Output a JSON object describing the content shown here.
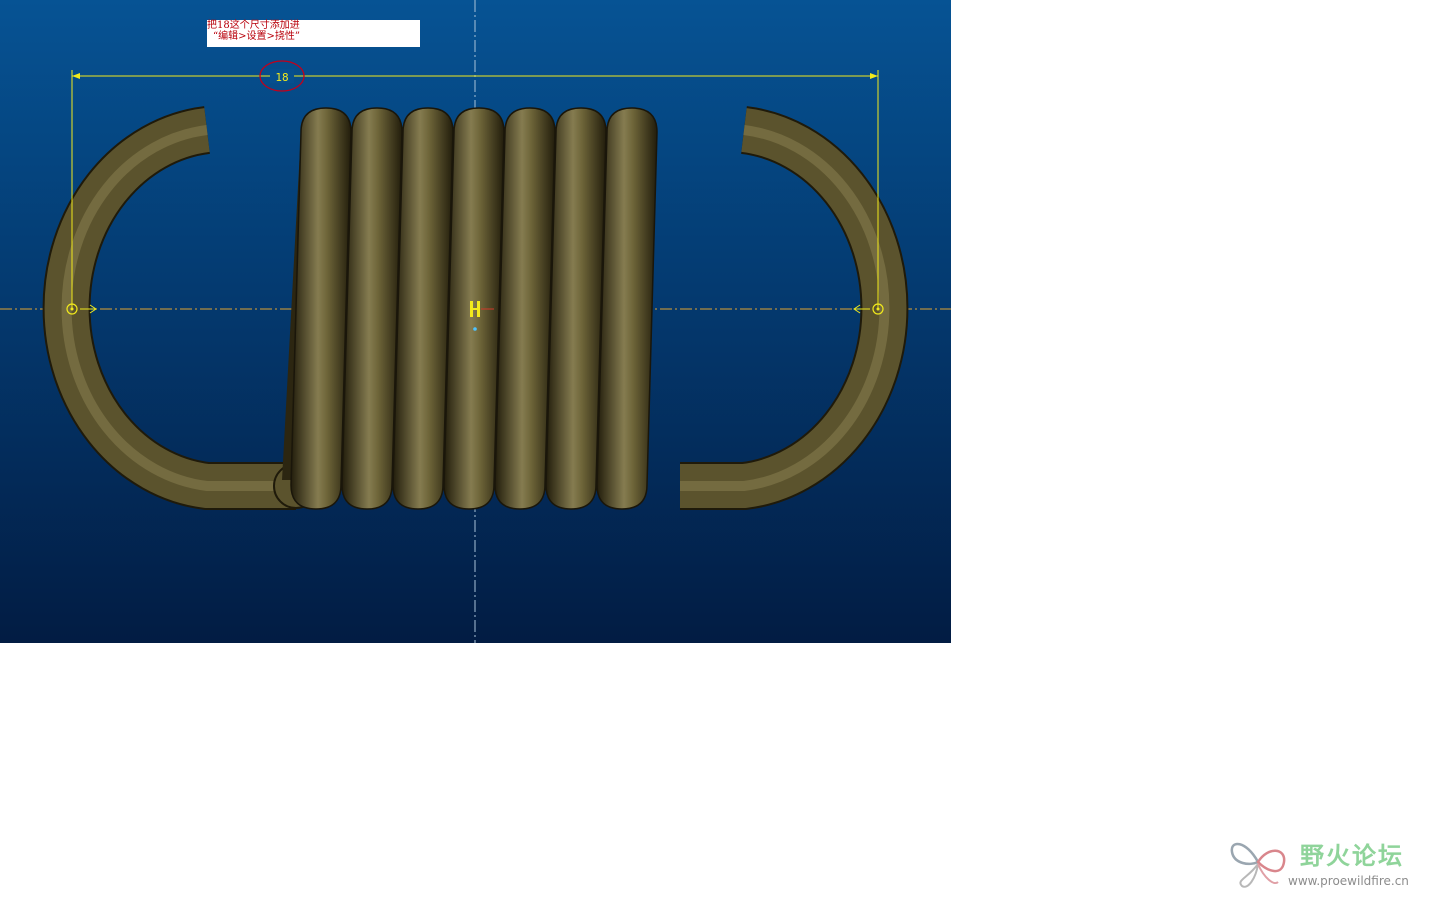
{
  "viewport": {
    "background_top": "#065394",
    "background_bottom": "#021c43"
  },
  "annotation": {
    "line1": "把18这个尺寸添加进",
    "line2": "“编辑>设置>挠性”",
    "text_color": "#b8000b"
  },
  "dimension": {
    "value": "18",
    "color": "#f2ea1c",
    "highlight_color": "#c2001b"
  },
  "spring": {
    "coil_color": "#5e5530",
    "shadow_color": "#26210e",
    "highlight_color": "#9a8f5c"
  },
  "watermark": {
    "title": "野火论坛",
    "url": "www.proewildfire.cn",
    "title_color": "#8fd49a",
    "url_color": "#8c8c8c",
    "icon": "butterfly-logo-icon"
  }
}
